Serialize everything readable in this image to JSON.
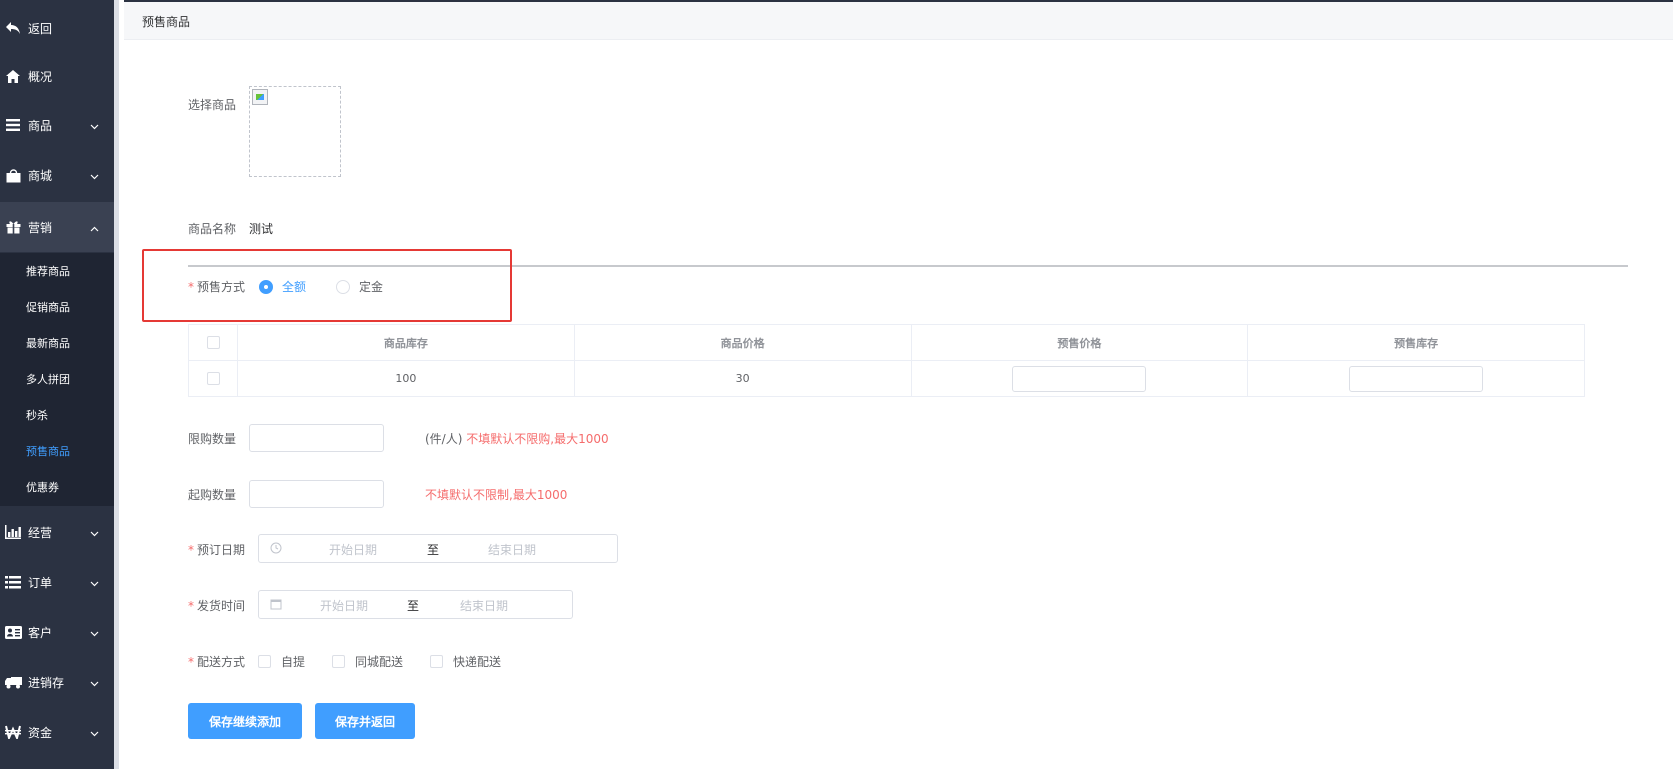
{
  "sidebar": {
    "items": [
      {
        "label": "返回",
        "icon": "back-arrow-icon"
      },
      {
        "label": "概况",
        "icon": "home-icon"
      },
      {
        "label": "商品",
        "icon": "list-bars-icon"
      },
      {
        "label": "商城",
        "icon": "shopping-bag-icon"
      },
      {
        "label": "营销",
        "icon": "gift-icon"
      },
      {
        "label": "经营",
        "icon": "bar-chart-icon"
      },
      {
        "label": "订单",
        "icon": "list-icon"
      },
      {
        "label": "客户",
        "icon": "id-card-icon"
      },
      {
        "label": "进销存",
        "icon": "truck-icon"
      },
      {
        "label": "资金",
        "icon": "won-icon"
      }
    ],
    "submenu": [
      {
        "label": "推荐商品"
      },
      {
        "label": "促销商品"
      },
      {
        "label": "最新商品"
      },
      {
        "label": "多人拼团"
      },
      {
        "label": "秒杀"
      },
      {
        "label": "预售商品"
      },
      {
        "label": "优惠券"
      }
    ],
    "active_sub": "预售商品",
    "open_menu": "营销"
  },
  "header": {
    "title": "预售商品"
  },
  "form": {
    "select_goods_label": "选择商品",
    "goods_name_label": "商品名称",
    "goods_name_value": "测试",
    "presale_mode": {
      "label": "预售方式",
      "options": [
        "全额",
        "定金"
      ],
      "selected": "全额"
    },
    "table": {
      "headers": [
        "商品库存",
        "商品价格",
        "预售价格",
        "预售库存"
      ],
      "rows": [
        {
          "stock": "100",
          "price": "30",
          "presale_price": "",
          "presale_stock": ""
        }
      ]
    },
    "limit_qty": {
      "label": "限购数量",
      "unit": "(件/人)",
      "hint": "不填默认不限购,最大1000"
    },
    "min_qty": {
      "label": "起购数量",
      "hint": "不填默认不限制,最大1000"
    },
    "booking_date": {
      "label": "预订日期",
      "start_placeholder": "开始日期",
      "separator": "至",
      "end_placeholder": "结束日期"
    },
    "ship_time": {
      "label": "发货时间",
      "start_placeholder": "开始日期",
      "separator": "至",
      "end_placeholder": "结束日期"
    },
    "delivery": {
      "label": "配送方式",
      "options": [
        "自提",
        "同城配送",
        "快递配送"
      ]
    },
    "buttons": {
      "save_continue": "保存继续添加",
      "save_return": "保存并返回"
    }
  },
  "colors": {
    "sidebar_bg": "#2b3242",
    "primary": "#409eff",
    "danger": "#f56c6c",
    "highlight_box": "#e53935"
  }
}
